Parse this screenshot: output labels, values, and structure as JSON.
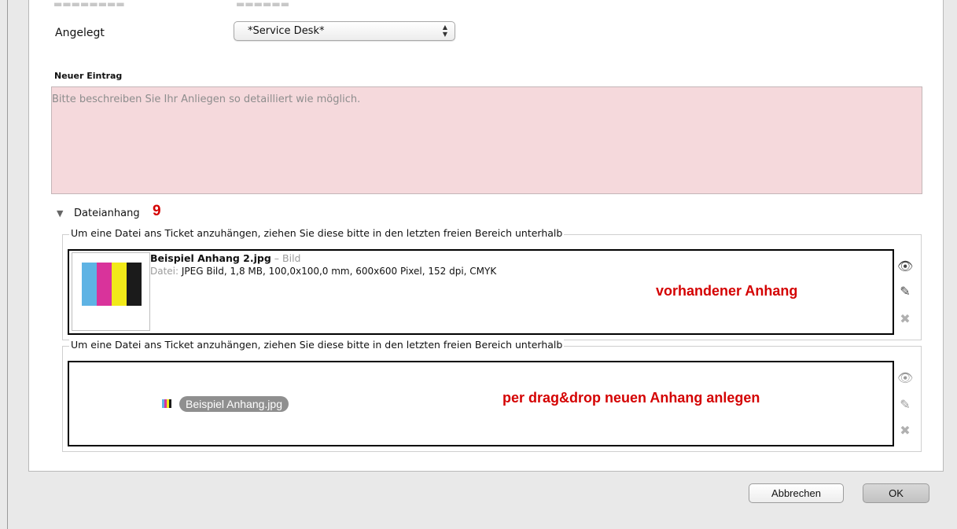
{
  "form": {
    "angelegt_label": "Angelegt",
    "angelegt_value": "*Service Desk*",
    "new_entry_label": "Neuer Eintrag",
    "new_entry_placeholder": "Bitte beschreiben Sie Ihr Anliegen so detailliert wie möglich.",
    "new_entry_value": ""
  },
  "attachments": {
    "section_label": "Dateianhang",
    "step_number": "9",
    "group_hint": "Um eine Datei ans Ticket anzuhängen, ziehen Sie diese bitte in den letzten freien Bereich unterhalb",
    "existing": {
      "filename": "Beispiel Anhang 2.jpg",
      "separator": " – ",
      "type": "Bild",
      "info_prefix": "Datei:",
      "info": "JPEG Bild, 1,8 MB, 100,0x100,0 mm, 600x600 Pixel, 152 dpi, CMYK",
      "annotation": "vorhandener Anhang",
      "thumb_colors": [
        "#5eb3e4",
        "#d9339b",
        "#f2ea1a",
        "#1b1b1b"
      ]
    },
    "drop": {
      "dragged_filename": "Beispiel Anhang.jpg",
      "annotation": "per drag&drop neuen Anhang anlegen"
    }
  },
  "buttons": {
    "cancel": "Abbrechen",
    "ok": "OK"
  },
  "icons": {
    "view": "eye-icon",
    "edit": "pencil-icon",
    "remove": "close-icon",
    "disclosure": "triangle-down-icon",
    "select_arrows": "updown-arrows-icon"
  },
  "colors": {
    "annotation_red": "#d40000",
    "entry_background": "#f5d9dc"
  }
}
